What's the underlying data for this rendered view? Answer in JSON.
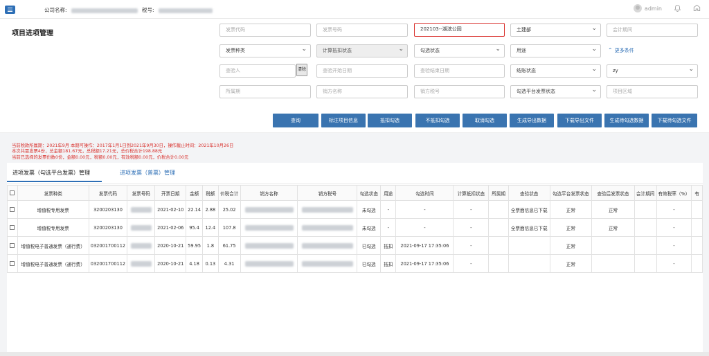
{
  "header": {
    "company_label": "公司名称:",
    "tax_label": "税号:",
    "username": "admin",
    "icons": {
      "menu": "menu-icon",
      "avatar": "avatar-icon",
      "bell": "bell-icon",
      "home": "home-icon"
    }
  },
  "filters": {
    "title": "项目进项管理",
    "invoice_code_placeholder": "发票代码",
    "invoice_number_placeholder": "发票号码",
    "project_value": "202103--湖滨公园",
    "department_value": "土建部",
    "accounting_period_placeholder": "会计期间",
    "invoice_type_label": "发票种类",
    "deduct_status_label": "计算抵扣状态",
    "select_status_label": "勾选状态",
    "usage_label": "用途",
    "more_conditions": "更多条件",
    "checker_placeholder": "查验人",
    "clear_label": "清除",
    "check_start_placeholder": "查验开始日期",
    "check_end_placeholder": "查验结束日期",
    "archive_status_label": "结账状态",
    "owner_value": "zy",
    "period_placeholder": "所属期",
    "seller_name_placeholder": "销方名称",
    "seller_tax_placeholder": "销方税号",
    "platform_status_label": "勾选平台发票状态",
    "project_area_placeholder": "项目区域"
  },
  "actions": [
    "查询",
    "标注项目信息",
    "抵扣勾选",
    "不抵扣勾选",
    "取消勾选",
    "生成导出数据",
    "下载导出文件",
    "生成待勾选数据",
    "下载待勾选文件"
  ],
  "notice": [
    "当前税款所属期：2021年9月 本期可操作：2017年1月1日到2021年9月30日，操作截止时间：2021年10月26日",
    "本次共需发票4份，总金额181.67元，总税额17.21元，总价税合计198.88元",
    "当前已选择的发票份数0份，金额0.00元，税额0.00元，有效税额0.00元，价税合计0.00元"
  ],
  "tabs": {
    "active": "进项发票（勾选平台发票）管理",
    "inactive": "进项发票（普票）管理"
  },
  "table": {
    "columns": [
      "发票种类",
      "发票代码",
      "发票号码",
      "开票日期",
      "金额",
      "税额",
      "价税合计",
      "销方名称",
      "销方税号",
      "勾选状态",
      "用途",
      "勾选时间",
      "计算抵扣状态",
      "所属期",
      "查验状态",
      "勾选平台发票状态",
      "查验后发票状态",
      "会计期间",
      "有效税率（%）",
      "有"
    ],
    "rows": [
      [
        "增值税专用发票",
        "3200203130",
        "",
        "2021-02-10",
        "22.14",
        "2.88",
        "25.02",
        "",
        "",
        "未勾选",
        "-",
        "-",
        "-",
        "",
        "全票面信息已下载",
        "正常",
        "正常",
        "",
        "-",
        ""
      ],
      [
        "增值税专用发票",
        "3200203130",
        "",
        "2021-02-06",
        "95.4",
        "12.4",
        "107.8",
        "",
        "",
        "未勾选",
        "-",
        "-",
        "-",
        "",
        "全票面信息已下载",
        "正常",
        "正常",
        "",
        "-",
        ""
      ],
      [
        "增值税电子普通发票（通行费）",
        "032001700112",
        "",
        "2020-10-21",
        "59.95",
        "1.8",
        "61.75",
        "",
        "",
        "已勾选",
        "抵扣",
        "2021-09-17 17:35:06",
        "-",
        "",
        "",
        "正常",
        "",
        "",
        "-",
        ""
      ],
      [
        "增值税电子普通发票（通行费）",
        "032001700112",
        "",
        "2020-10-21",
        "4.18",
        "0.13",
        "4.31",
        "",
        "",
        "已勾选",
        "抵扣",
        "2021-09-17 17:35:06",
        "-",
        "",
        "",
        "正常",
        "",
        "",
        "-",
        ""
      ]
    ]
  }
}
